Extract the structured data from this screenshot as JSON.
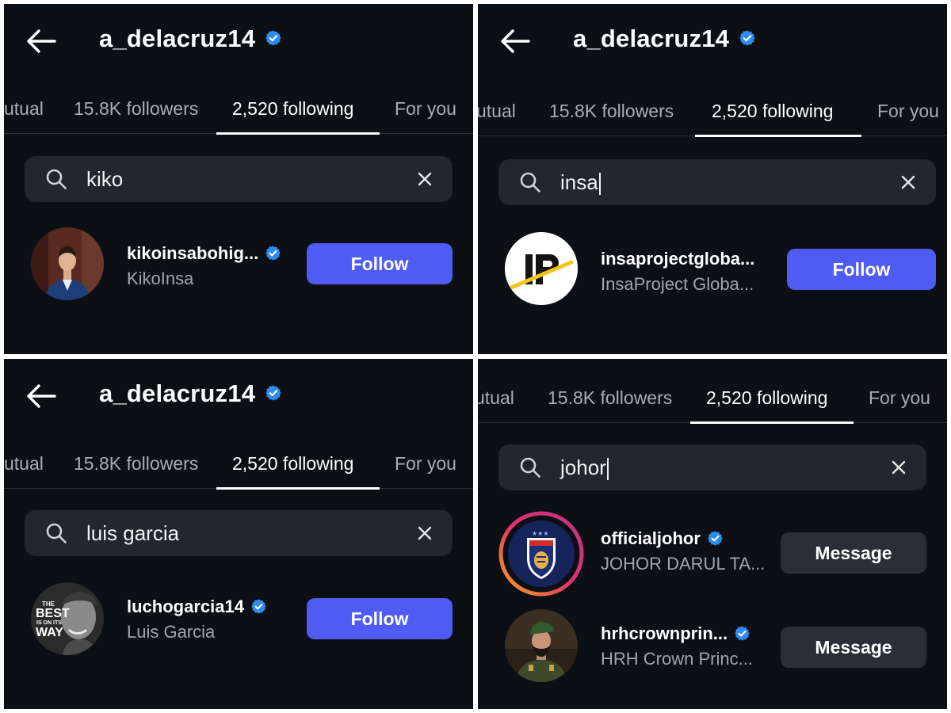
{
  "colors": {
    "panel_bg": "#0c0f14",
    "search_bg": "#22262d",
    "follow_button": "#4f5bf5",
    "message_button": "#2a2e35",
    "verified_badge": "#2e8cf0",
    "muted_text": "#a0a5ad"
  },
  "panels": [
    {
      "title": "a_delacruz14",
      "tabs": [
        "utual",
        "15.8K followers",
        "2,520 following",
        "For you"
      ],
      "active_tab": "2,520 following",
      "search_query": "kiko",
      "results": [
        {
          "handle": "kikoinsabohig...",
          "name": "KikoInsa",
          "verified": true,
          "action": "Follow",
          "avatar": "person-avatar"
        }
      ]
    },
    {
      "title": "a_delacruz14",
      "tabs": [
        "utual",
        "15.8K followers",
        "2,520 following",
        "For you"
      ],
      "active_tab": "2,520 following",
      "search_query": "insa",
      "results": [
        {
          "handle": "insaprojectgloba...",
          "name": "InsaProject Globa...",
          "verified": false,
          "action": "Follow",
          "avatar": "ip-logo-avatar"
        }
      ]
    },
    {
      "title": "a_delacruz14",
      "tabs": [
        "utual",
        "15.8K followers",
        "2,520 following",
        "For you"
      ],
      "active_tab": "2,520 following",
      "search_query": "luis garcia",
      "results": [
        {
          "handle": "luchogarcia14",
          "name": "Luis Garcia",
          "verified": true,
          "action": "Follow",
          "avatar": "person-avatar",
          "avatar_text": [
            "THE",
            "BEST",
            "IS ON ITS",
            "WAY"
          ]
        }
      ]
    },
    {
      "tabs": [
        "utual",
        "15.8K followers",
        "2,520 following",
        "For you"
      ],
      "active_tab": "2,520 following",
      "search_query": "johor",
      "results": [
        {
          "handle": "officialjohor",
          "name": "JOHOR DARUL TA...",
          "verified": true,
          "action": "Message",
          "avatar": "club-crest-avatar",
          "has_story_ring": true
        },
        {
          "handle": "hrhcrownprin...",
          "name": "HRH Crown Princ...",
          "verified": true,
          "action": "Message",
          "avatar": "person-avatar"
        }
      ]
    }
  ]
}
